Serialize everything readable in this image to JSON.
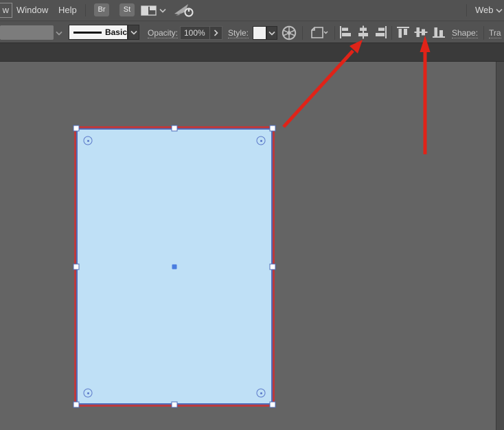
{
  "menubar": {
    "clipped_menu": "w",
    "window": "Window",
    "help": "Help",
    "bridge_badge": "Br",
    "stock_badge": "St",
    "workspace": "Web"
  },
  "controlbar": {
    "brush_definition": "Basic",
    "opacity_label": "Opacity:",
    "opacity_value": "100%",
    "style_label": "Style:",
    "shape_label": "Shape:",
    "transform_label": "Tra"
  },
  "icons": {
    "workspace_layout": "two-pane-layout-icon",
    "rocket": "rocket-with-power-icon",
    "recolor_wheel": "color-wheel-icon",
    "document_arrange": "page-with-chevron-icon",
    "align_group_horizontal": [
      "align-horizontal-left",
      "align-horizontal-center",
      "align-horizontal-right"
    ],
    "align_group_vertical": [
      "align-vertical-top",
      "align-vertical-center",
      "align-vertical-bottom"
    ]
  },
  "canvas_object": {
    "type": "rectangle",
    "selected": true,
    "fill_color": "#bfe0f6",
    "stroke_color": "#bb3a3c",
    "selection_color": "#4e6cb8"
  },
  "annotations": {
    "arrow_color": "#e02318",
    "arrow_1_target": "align-horizontal-center",
    "arrow_2_target": "align-vertical-center"
  }
}
